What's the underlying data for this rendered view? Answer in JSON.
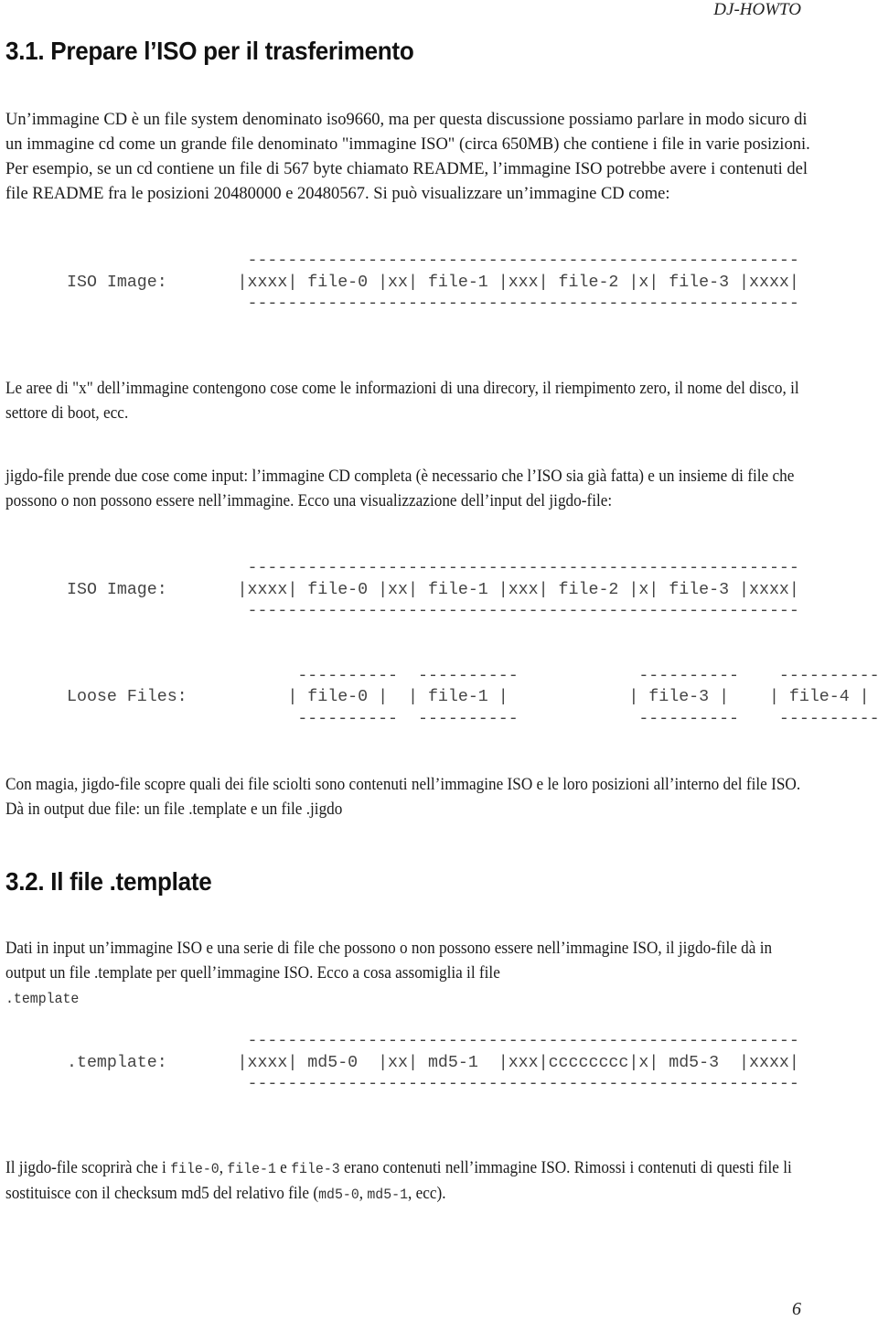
{
  "header": {
    "running_title": "DJ-HOWTO"
  },
  "section_3_1": {
    "title": "3.1. Prepare l’ISO per il trasferimento",
    "p1": "Un’immagine CD è un file system denominato iso9660, ma per questa discussione possiamo parlare in modo sicuro di un immagine cd come un grande file denominato \"immagine ISO\" (circa 650MB) che contiene i file in varie posizioni. Per esempio, se un cd contiene un file di 567 byte chiamato README, l’immagine ISO potrebbe avere i contenuti del file README fra le posizioni 20480000 e 20480567. Si può visualizzare un’immagine CD come:",
    "diagram1": "                  -------------------------------------------------------\nISO Image:       |xxxx| file-0 |xx| file-1 |xxx| file-2 |x| file-3 |xxxx|\n                  -------------------------------------------------------",
    "p2": "Le aree di \"x\" dell’immagine contengono cose come le informazioni di una direcory, il riempimento zero, il nome del disco, il settore di boot, ecc.",
    "p3": "jigdo-file prende due cose come input: l’immagine CD completa (è necessario che l’ISO sia già fatta) e un insieme di file che possono o non possono essere nell’immagine. Ecco una visualizzazione dell’input del jigdo-file:",
    "diagram2": "                  -------------------------------------------------------\nISO Image:       |xxxx| file-0 |xx| file-1 |xxx| file-2 |x| file-3 |xxxx|\n                  -------------------------------------------------------\n\n\n                       ----------  ----------            ----------    ----------\nLoose Files:          | file-0 |  | file-1 |            | file-3 |    | file-4 |\n                       ----------  ----------            ----------    ----------",
    "p4": "Con magia, jigdo-file scopre quali dei file sciolti sono contenuti nell’immagine ISO e le loro posizioni all’interno del file ISO. Dà in output due file: un file .template e un file .jigdo"
  },
  "section_3_2": {
    "title": "3.2. Il file .template",
    "p1_text": "Dati in input un’immagine ISO e una serie di file che possono o non possono essere nell’immagine ISO, il jigdo-file dà in output un file .template per quell’immagine ISO. Ecco a cosa assomiglia il file",
    "p1_code": ".template",
    "diagram3": "                  -------------------------------------------------------\n.template:       |xxxx| md5-0  |xx| md5-1  |xxx|cccccccc|x| md5-3  |xxxx|\n                  -------------------------------------------------------",
    "p2_a": "Il jigdo-file scoprirà che i ",
    "p2_code1": "file-0",
    "p2_b": ", ",
    "p2_code2": "file-1",
    "p2_c": " e ",
    "p2_code3": "file-3",
    "p2_d": " erano contenuti nell’immagine ISO. Rimossi i contenuti di questi file li sostituisce con il checksum md5 del relativo file (",
    "p2_code4": "md5-0",
    "p2_e": ", ",
    "p2_code5": "md5-1",
    "p2_f": ", ecc)."
  },
  "footer": {
    "page_number": "6"
  }
}
